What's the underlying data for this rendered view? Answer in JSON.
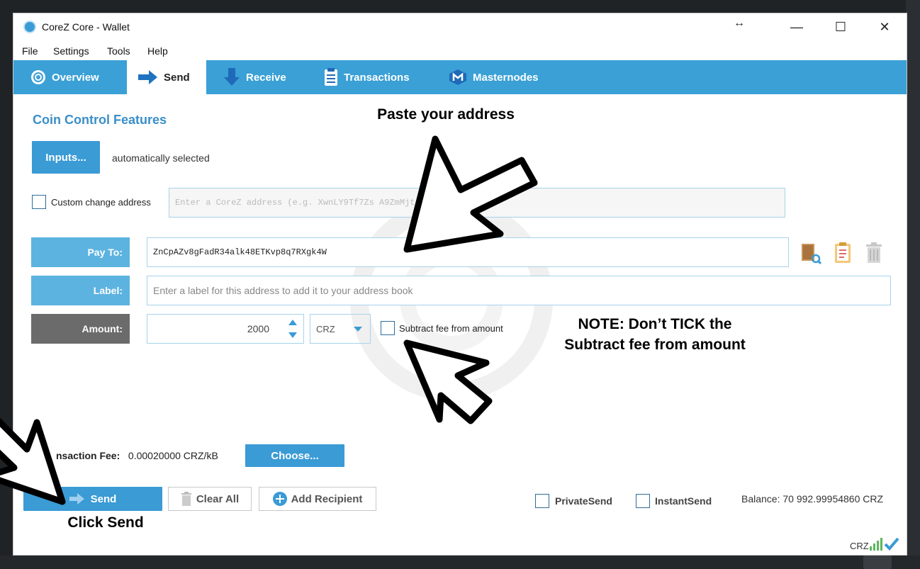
{
  "window": {
    "title": "CoreZ Core - Wallet"
  },
  "menu": [
    "File",
    "Settings",
    "Tools",
    "Help"
  ],
  "tabs": [
    {
      "label": "Overview",
      "icon": "overview-icon"
    },
    {
      "label": "Send",
      "icon": "send-arrow-icon",
      "active": true
    },
    {
      "label": "Receive",
      "icon": "receive-arrow-icon"
    },
    {
      "label": "Transactions",
      "icon": "transactions-icon"
    },
    {
      "label": "Masternodes",
      "icon": "masternodes-icon"
    }
  ],
  "coin_control": {
    "title": "Coin Control Features",
    "inputs_button": "Inputs...",
    "inputs_status": "automatically selected",
    "custom_change_label": "Custom change address",
    "custom_change_checked": false,
    "change_placeholder": "Enter a CoreZ address (e.g. XwnLY9Tf7Zs A9ZmMjt4KPwg)"
  },
  "recipient": {
    "pay_to_label": "Pay To:",
    "pay_to_value": "ZnCpAZv8gFadR34alk48ETKvp8q7RXgk4W",
    "label_label": "Label:",
    "label_placeholder": "Enter a label for this address to add it to your address book",
    "amount_label": "Amount:",
    "amount_value": "2000",
    "currency": "CRZ",
    "subtract_fee_label": "Subtract fee from amount",
    "subtract_fee_checked": false
  },
  "fee": {
    "label": "Transaction Fee:",
    "label_visible": "nsaction Fee:",
    "value": "0.00020000 CRZ/kB",
    "choose_button": "Choose..."
  },
  "actions": {
    "send": "Send",
    "clear_all": "Clear All",
    "add_recipient": "Add Recipient",
    "private_send": "PrivateSend",
    "instant_send": "InstantSend",
    "balance": "Balance: 70 992.99954860 CRZ"
  },
  "status_bar": {
    "currency": "CRZ"
  },
  "annotations": {
    "paste": "Paste your address",
    "note_line1": "NOTE: Don’t TICK the",
    "note_line2": "Subtract fee from amount",
    "click_send": "Click Send"
  },
  "colors": {
    "accent": "#3a9bd5",
    "tab_bar": "#3aa0d6",
    "row_label": "#5cb3e0",
    "amount_label": "#6b6b6b"
  }
}
